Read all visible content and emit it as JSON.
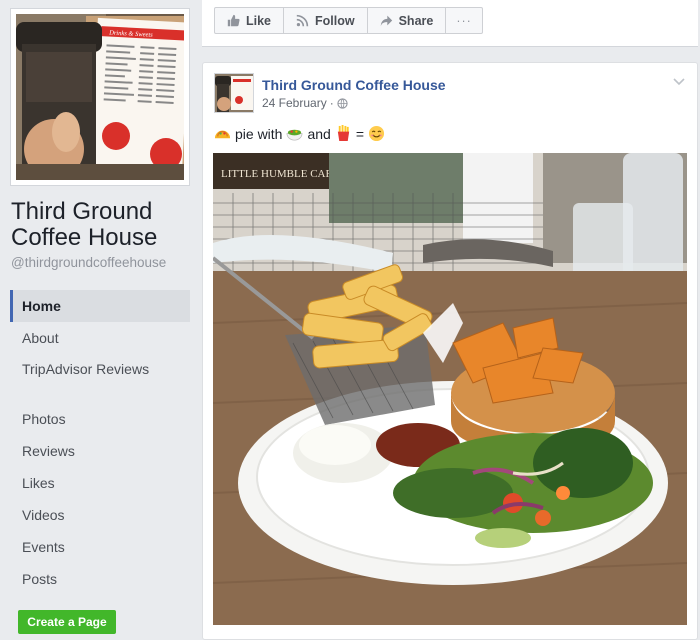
{
  "page": {
    "name": "Third Ground Coffee House",
    "handle": "@thirdgroundcoffeehouse"
  },
  "nav": {
    "items": [
      {
        "label": "Home",
        "active": true
      },
      {
        "label": "About"
      },
      {
        "label": "TripAdvisor Reviews"
      },
      {
        "label": "Photos"
      },
      {
        "label": "Reviews"
      },
      {
        "label": "Likes"
      },
      {
        "label": "Videos"
      },
      {
        "label": "Events"
      },
      {
        "label": "Posts"
      }
    ]
  },
  "create_page_label": "Create a Page",
  "actionbar": {
    "like_label": "Like",
    "follow_label": "Follow",
    "share_label": "Share",
    "more_label": "···"
  },
  "post": {
    "author": "Third Ground Coffee House",
    "date": "24 February",
    "meta_separator": "·",
    "text_parts": [
      "pie with",
      "and",
      "="
    ],
    "emojis": [
      "taco-emoji",
      "salad-emoji",
      "fries-emoji",
      "smiling-face-emoji"
    ]
  },
  "profile_pic_text": "Drinks & Sweets",
  "photo_sign_text": "LITTLE HUMBLE CAFE",
  "colors": {
    "link": "#365899",
    "accent": "#4267b2",
    "create_button": "#42b72a"
  }
}
